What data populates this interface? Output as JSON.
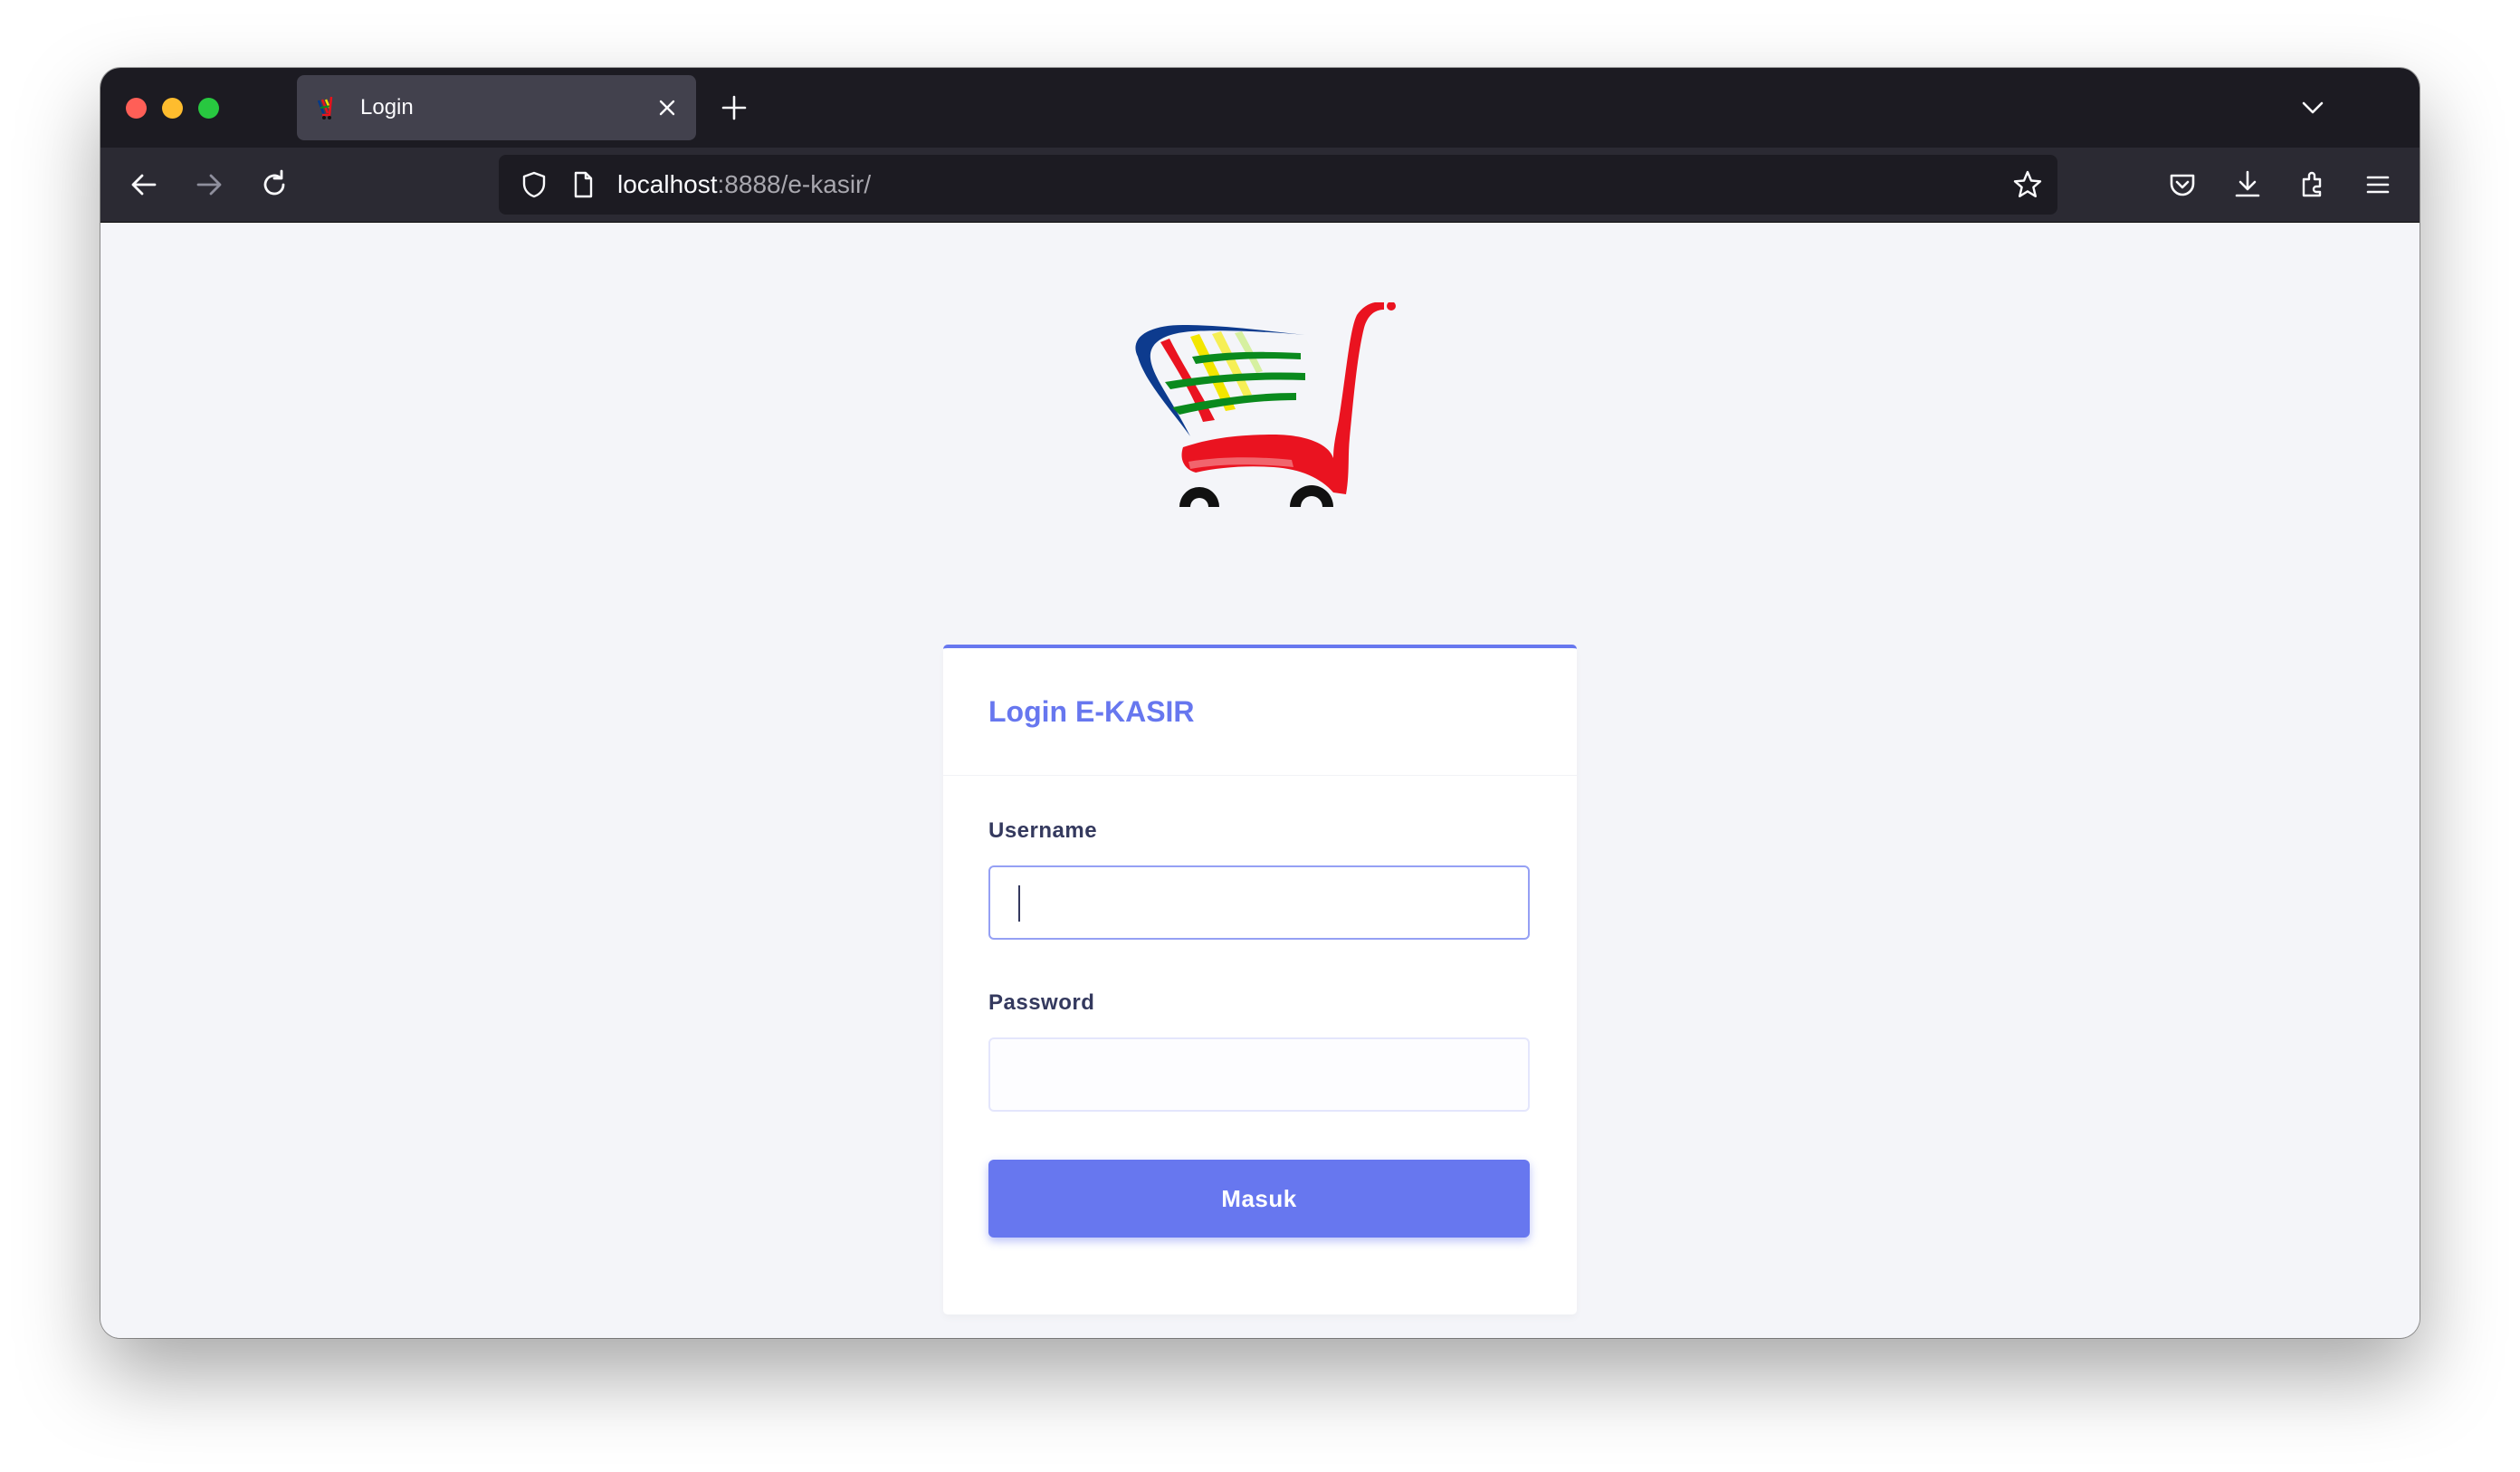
{
  "browser": {
    "tab": {
      "title": "Login"
    },
    "url": {
      "host": "localhost",
      "rest": ":8888/e-kasir/"
    }
  },
  "icons": {
    "favicon": "shopping-cart-icon",
    "close": "close-icon",
    "new_tab": "plus-icon",
    "tab_list": "chevron-down-icon",
    "back": "arrow-left-icon",
    "forward": "arrow-right-icon",
    "reload": "reload-icon",
    "shield": "shield-icon",
    "page": "page-icon",
    "bookmark": "star-icon",
    "pocket": "pocket-icon",
    "downloads": "download-icon",
    "extensions": "puzzle-icon",
    "menu": "hamburger-menu-icon"
  },
  "colors": {
    "accent": "#6777ef",
    "tabstrip": "#1c1b22",
    "toolbar": "#2b2a33",
    "page_bg": "#f4f5f9"
  },
  "login": {
    "title": "Login E-KASIR",
    "username_label": "Username",
    "username_value": "",
    "password_label": "Password",
    "password_value": "",
    "submit_label": "Masuk"
  }
}
